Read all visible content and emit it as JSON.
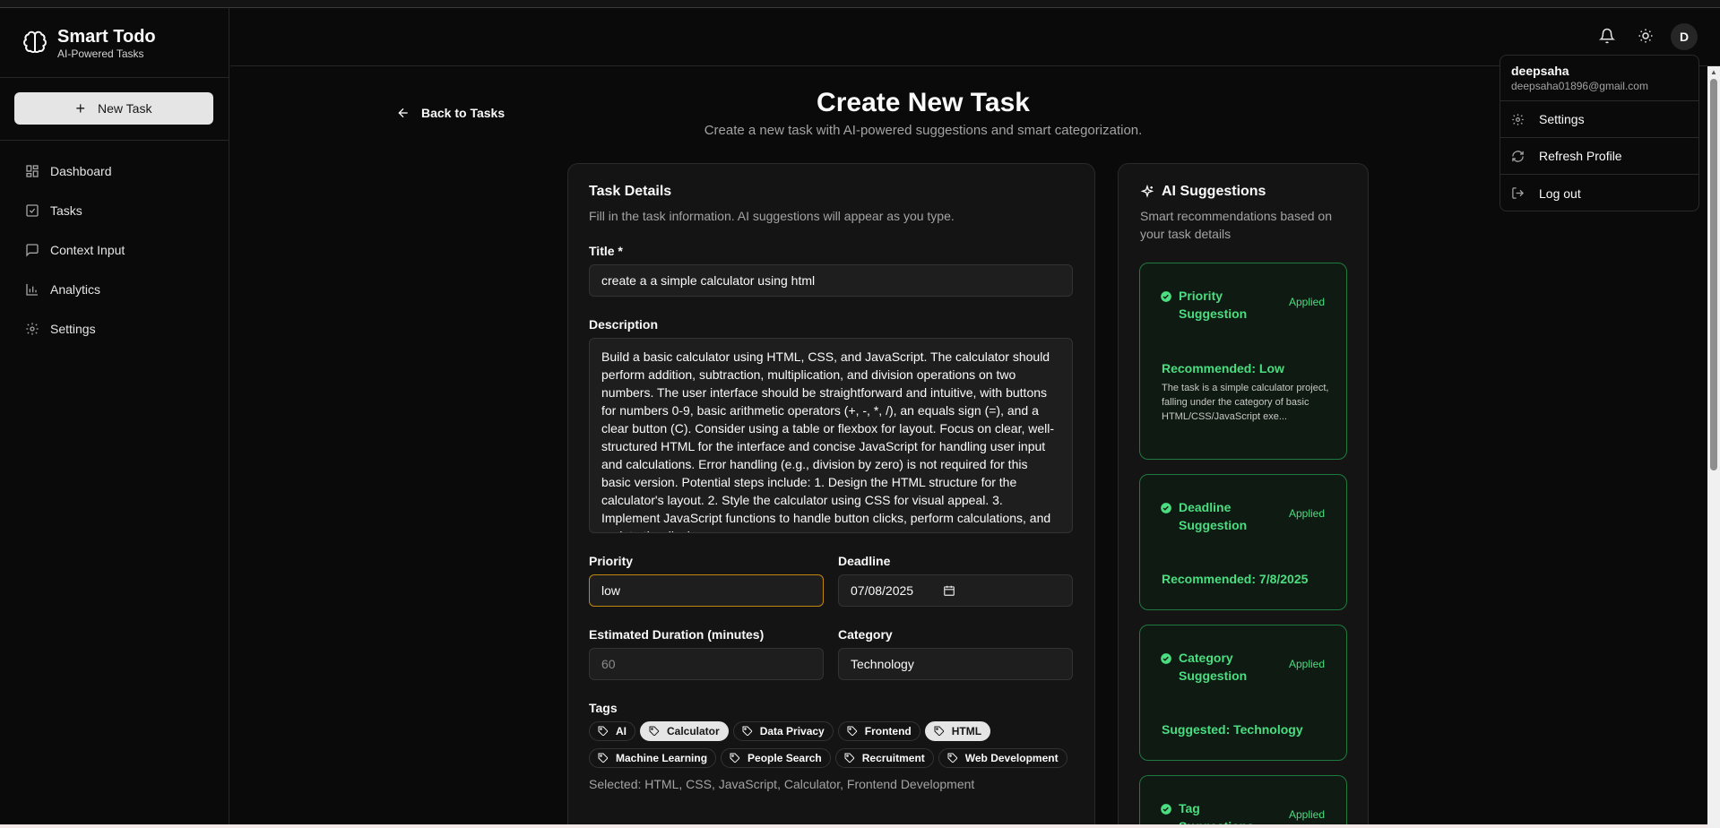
{
  "sidebar": {
    "brand_title": "Smart Todo",
    "brand_subtitle": "AI-Powered Tasks",
    "new_task_label": "New Task",
    "items": [
      {
        "label": "Dashboard",
        "icon": "dashboard-icon"
      },
      {
        "label": "Tasks",
        "icon": "tasks-icon"
      },
      {
        "label": "Context Input",
        "icon": "message-icon"
      },
      {
        "label": "Analytics",
        "icon": "chart-icon"
      },
      {
        "label": "Settings",
        "icon": "gear-icon"
      }
    ]
  },
  "header": {
    "avatar_initial": "D"
  },
  "main": {
    "back_label": "Back to Tasks",
    "title": "Create New Task",
    "subtitle": "Create a new task with AI-powered suggestions and smart categorization."
  },
  "form": {
    "card_title": "Task Details",
    "card_desc": "Fill in the task information. AI suggestions will appear as you type.",
    "title_label": "Title *",
    "title_value": "create a a simple calculator using html",
    "description_label": "Description",
    "description_value": "Build a basic calculator using HTML, CSS, and JavaScript.  The calculator should perform addition, subtraction, multiplication, and division operations on two numbers.  The user interface should be straightforward and intuitive, with buttons for numbers 0-9, basic arithmetic operators (+, -, *, /), an equals sign (=), and a clear button (C).  Consider using a table or flexbox for layout.  Focus on clear, well-structured HTML for the interface and concise JavaScript for handling user input and calculations.  Error handling (e.g., division by zero) is not required for this basic version.  Potential steps include: 1. Design the HTML structure for the calculator's layout. 2. Style the calculator using CSS for visual appeal. 3. Implement JavaScript functions to handle button clicks, perform calculations, and update the display.",
    "priority_label": "Priority",
    "priority_value": "low",
    "deadline_label": "Deadline",
    "deadline_value": "07/08/2025",
    "duration_label": "Estimated Duration (minutes)",
    "duration_placeholder": "60",
    "category_label": "Category",
    "category_value": "Technology",
    "tags_label": "Tags",
    "tags": [
      {
        "label": "AI",
        "selected": false
      },
      {
        "label": "Calculator",
        "selected": true
      },
      {
        "label": "Data Privacy",
        "selected": false
      },
      {
        "label": "Frontend",
        "selected": false
      },
      {
        "label": "HTML",
        "selected": true
      },
      {
        "label": "Machine Learning",
        "selected": false
      },
      {
        "label": "People Search",
        "selected": false
      },
      {
        "label": "Recruitment",
        "selected": false
      },
      {
        "label": "Web Development",
        "selected": false
      }
    ],
    "selected_text": "Selected: HTML, CSS, JavaScript, Calculator, Frontend Development"
  },
  "ai": {
    "title": "AI Suggestions",
    "desc": "Smart recommendations based on your task details",
    "suggestions": [
      {
        "name": "Priority Suggestion",
        "status": "Applied",
        "recommendation": "Recommended: Low",
        "text": "The task is a simple calculator project, falling under the category of basic HTML/CSS/JavaScript exe..."
      },
      {
        "name": "Deadline Suggestion",
        "status": "Applied",
        "recommendation": "Recommended: 7/8/2025"
      },
      {
        "name": "Category Suggestion",
        "status": "Applied",
        "recommendation": "Suggested: Technology"
      },
      {
        "name": "Tag Suggestions",
        "status": "Applied"
      }
    ]
  },
  "user_menu": {
    "username": "deepsaha",
    "email": "deepsaha01896@gmail.com",
    "items": [
      {
        "label": "Settings",
        "icon": "gear-icon"
      },
      {
        "label": "Refresh Profile",
        "icon": "refresh-icon"
      },
      {
        "label": "Log out",
        "icon": "logout-icon"
      }
    ]
  },
  "colors": {
    "accent_green": "#4ade80",
    "focus_orange": "#c2870f",
    "background": "#0a0a0a"
  }
}
